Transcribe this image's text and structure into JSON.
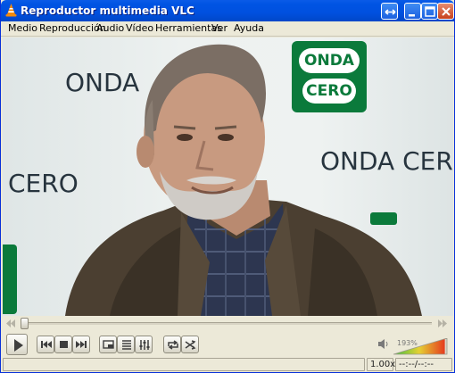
{
  "window": {
    "title": "Reproductor multimedia VLC",
    "titlebar_color": "#0054e3",
    "buttons": [
      "resize-icon",
      "minimize-icon",
      "maximize-icon",
      "close-icon"
    ]
  },
  "menu": {
    "items": [
      "Medio",
      "Reproducción",
      "Audio",
      "Vídeo",
      "Herramientas",
      "Ver",
      "Ayuda"
    ]
  },
  "video": {
    "wall_text": [
      "ONDA",
      "ONDA CERO",
      "CERO"
    ],
    "logo_line1": "ONDA",
    "logo_line2": "CERO",
    "logo_color": "#0b7a3b"
  },
  "controls": {
    "seek_position": 0.0,
    "volume_label": "193%",
    "volume_level": 0.96,
    "buttons": [
      "play-icon",
      "previous-icon",
      "stop-icon",
      "next-icon",
      "fullscreen-icon",
      "playlist-icon",
      "equalizer-icon",
      "loop-icon",
      "shuffle-icon"
    ]
  },
  "status": {
    "speed": "1.00x",
    "time": "--:--/--:--"
  }
}
